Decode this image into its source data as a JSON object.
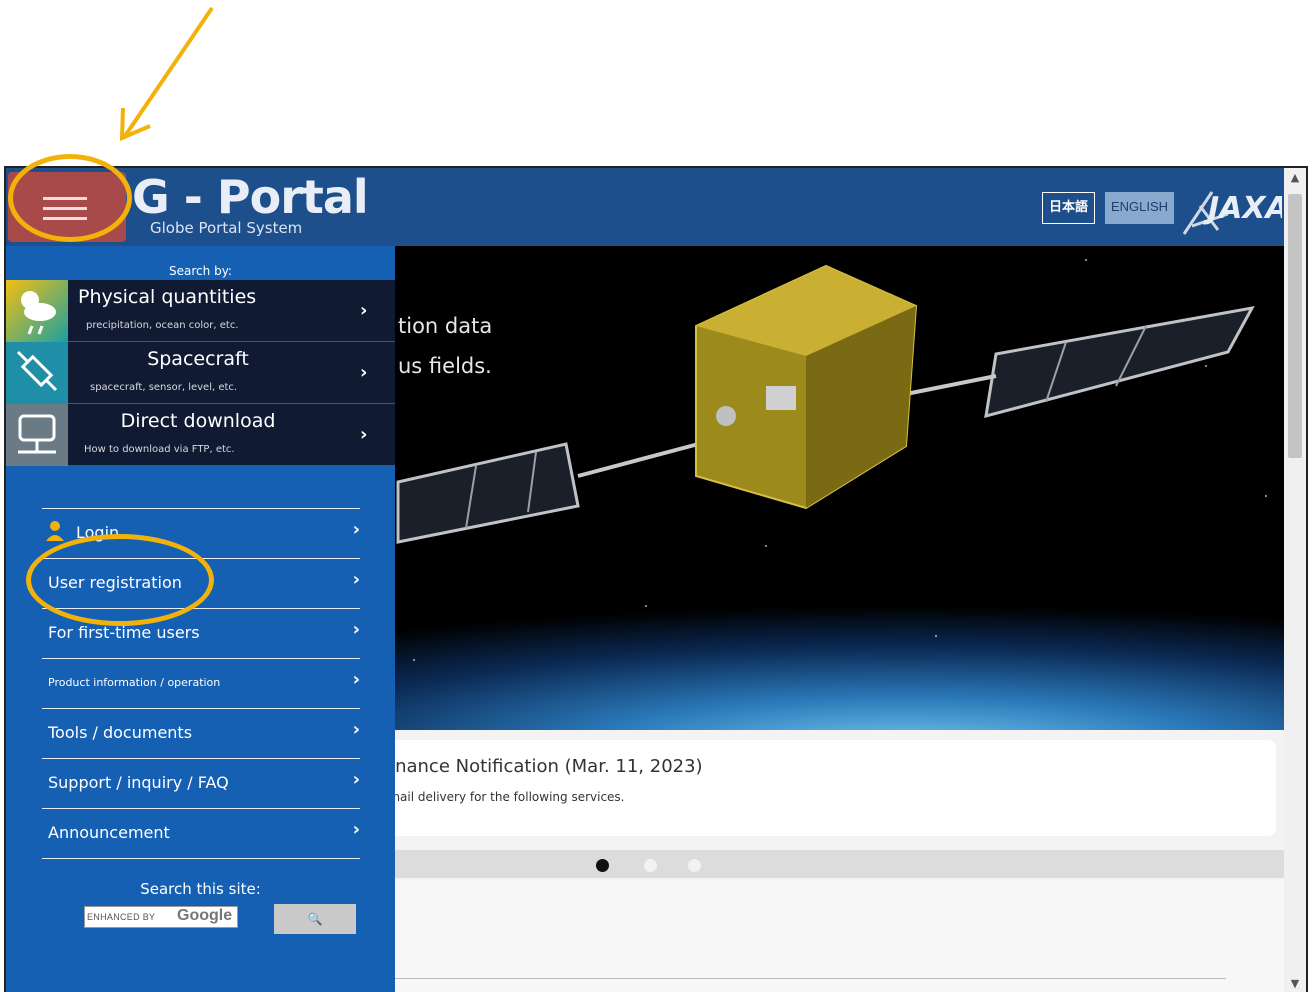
{
  "header": {
    "logo_main": "G - Portal",
    "logo_sub": "Globe Portal System",
    "lang_japanese": "日本語",
    "lang_english": "ENGLISH",
    "org_logo": "JAXA"
  },
  "drawer": {
    "search_by": "Search by:",
    "categories": [
      {
        "title": "Physical quantities",
        "sub": "precipitation, ocean color, etc.",
        "icon": "weather-icon"
      },
      {
        "title": "Spacecraft",
        "sub": "spacecraft, sensor, level, etc.",
        "icon": "satellite-icon"
      },
      {
        "title": "Direct download",
        "sub": "How to download via FTP, etc.",
        "icon": "network-computer-icon"
      }
    ],
    "nav_items": [
      {
        "label": "Login"
      },
      {
        "label": "User registration"
      },
      {
        "label": "For first-time users"
      },
      {
        "label": "Product information / operation"
      },
      {
        "label": "Tools / documents"
      },
      {
        "label": "Support / inquiry / FAQ"
      },
      {
        "label": "Announcement"
      }
    ],
    "site_search_label": "Search this site:",
    "google_prefix": "ENHANCED BY",
    "google_word": "Google",
    "search_button": "🔍"
  },
  "hero": {
    "line1": "tion data",
    "line2": "us fields."
  },
  "news": {
    "title": "enance Notification (Mar. 11, 2023)",
    "subtitle": "-mail delivery for the following services."
  },
  "carousel": {
    "dot_colors": [
      "#111111",
      "#f2f2f2",
      "#f2f2f2"
    ]
  },
  "colors": {
    "header_bg": "#1d4f8c",
    "drawer_bg": "#1560b3",
    "menu_button": "#a84a4a",
    "annotation": "#f2b20a"
  }
}
